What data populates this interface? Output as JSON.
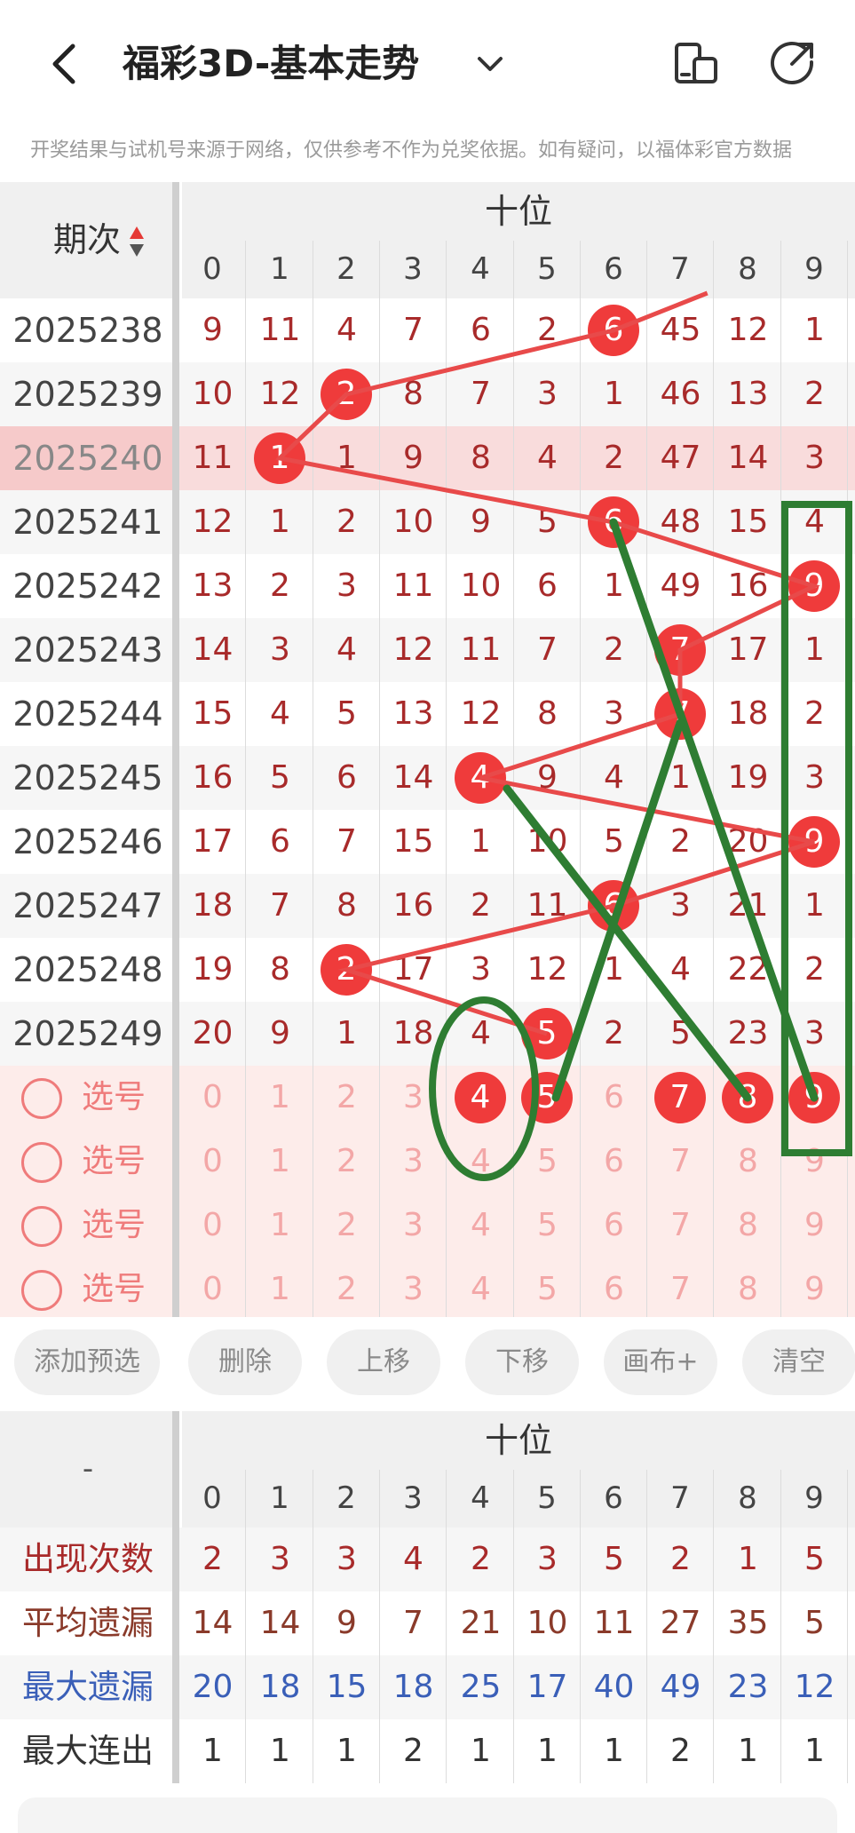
{
  "header": {
    "title": "福彩3D-基本走势",
    "back_icon": "chevron-left-icon",
    "dropdown_icon": "chevron-down-icon",
    "icon_1": "phone-switch-icon",
    "icon_2": "share-arrow-icon"
  },
  "notice": "开奖结果与试机号来源于网络，仅供参考不作为兑奖依据。如有疑问，以福体彩官方数据",
  "table": {
    "period_header": "期次",
    "section_title": "十位",
    "digits": [
      "0",
      "1",
      "2",
      "3",
      "4",
      "5",
      "6",
      "7",
      "8",
      "9"
    ],
    "rows": [
      {
        "period": "2025238",
        "cells": [
          "9",
          "11",
          "4",
          "7",
          "6",
          "2",
          "6",
          "45",
          "12",
          "1"
        ],
        "hit": 6,
        "highlight": false
      },
      {
        "period": "2025239",
        "cells": [
          "10",
          "12",
          "2",
          "8",
          "7",
          "3",
          "1",
          "46",
          "13",
          "2"
        ],
        "hit": 2,
        "highlight": false
      },
      {
        "period": "2025240",
        "cells": [
          "11",
          "1",
          "1",
          "9",
          "8",
          "4",
          "2",
          "47",
          "14",
          "3"
        ],
        "hit": 1,
        "highlight": true
      },
      {
        "period": "2025241",
        "cells": [
          "12",
          "1",
          "2",
          "10",
          "9",
          "5",
          "6",
          "48",
          "15",
          "4"
        ],
        "hit": 6,
        "highlight": false
      },
      {
        "period": "2025242",
        "cells": [
          "13",
          "2",
          "3",
          "11",
          "10",
          "6",
          "1",
          "49",
          "16",
          "9"
        ],
        "hit": 9,
        "highlight": false
      },
      {
        "period": "2025243",
        "cells": [
          "14",
          "3",
          "4",
          "12",
          "11",
          "7",
          "2",
          "7",
          "17",
          "1"
        ],
        "hit": 7,
        "highlight": false
      },
      {
        "period": "2025244",
        "cells": [
          "15",
          "4",
          "5",
          "13",
          "12",
          "8",
          "3",
          "7",
          "18",
          "2"
        ],
        "hit": 7,
        "highlight": false
      },
      {
        "period": "2025245",
        "cells": [
          "16",
          "5",
          "6",
          "14",
          "4",
          "9",
          "4",
          "1",
          "19",
          "3"
        ],
        "hit": 4,
        "highlight": false
      },
      {
        "period": "2025246",
        "cells": [
          "17",
          "6",
          "7",
          "15",
          "1",
          "10",
          "5",
          "2",
          "20",
          "9"
        ],
        "hit": 9,
        "highlight": false
      },
      {
        "period": "2025247",
        "cells": [
          "18",
          "7",
          "8",
          "16",
          "2",
          "11",
          "6",
          "3",
          "21",
          "1"
        ],
        "hit": 6,
        "highlight": false
      },
      {
        "period": "2025248",
        "cells": [
          "19",
          "8",
          "2",
          "17",
          "3",
          "12",
          "1",
          "4",
          "22",
          "2"
        ],
        "hit": 2,
        "highlight": false
      },
      {
        "period": "2025249",
        "cells": [
          "20",
          "9",
          "1",
          "18",
          "4",
          "5",
          "2",
          "5",
          "23",
          "3"
        ],
        "hit": 5,
        "highlight": false
      }
    ],
    "select_label": "选号",
    "select_rows": [
      {
        "cells": [
          "0",
          "1",
          "2",
          "3",
          "4",
          "5",
          "6",
          "7",
          "8",
          "9"
        ],
        "selected": [
          4,
          5,
          7,
          8,
          9
        ]
      },
      {
        "cells": [
          "0",
          "1",
          "2",
          "3",
          "4",
          "5",
          "6",
          "7",
          "8",
          "9"
        ],
        "selected": []
      },
      {
        "cells": [
          "0",
          "1",
          "2",
          "3",
          "4",
          "5",
          "6",
          "7",
          "8",
          "9"
        ],
        "selected": []
      },
      {
        "cells": [
          "0",
          "1",
          "2",
          "3",
          "4",
          "5",
          "6",
          "7",
          "8",
          "9"
        ],
        "selected": []
      }
    ]
  },
  "buttons": [
    "添加预选",
    "删除",
    "上移",
    "下移",
    "画布+",
    "清空"
  ],
  "stats": {
    "corner": "-",
    "section_title": "十位",
    "digits": [
      "0",
      "1",
      "2",
      "3",
      "4",
      "5",
      "6",
      "7",
      "8",
      "9"
    ],
    "rows": [
      {
        "label": "出现次数",
        "values": [
          "2",
          "3",
          "3",
          "4",
          "2",
          "3",
          "5",
          "2",
          "1",
          "5"
        ],
        "label_color": "#a82a2a",
        "value_color": "#a82a2a"
      },
      {
        "label": "平均遗漏",
        "values": [
          "14",
          "14",
          "9",
          "7",
          "21",
          "10",
          "11",
          "27",
          "35",
          "5"
        ],
        "label_color": "#8a3a2a",
        "value_color": "#8a3a2a"
      },
      {
        "label": "最大遗漏",
        "values": [
          "20",
          "18",
          "15",
          "18",
          "25",
          "17",
          "40",
          "49",
          "23",
          "12"
        ],
        "label_color": "#3a5fb8",
        "value_color": "#3a5fb8"
      },
      {
        "label": "最大连出",
        "values": [
          "1",
          "1",
          "1",
          "2",
          "1",
          "1",
          "1",
          "2",
          "1",
          "1"
        ],
        "label_color": "#333333",
        "value_color": "#333333"
      }
    ]
  },
  "colors": {
    "ball": "#ef3b3b",
    "trend_line": "#e84a4a",
    "annotation": "#2e7d32",
    "highlight_row": "#f9dcdc",
    "select_bg": "#fdecea"
  }
}
